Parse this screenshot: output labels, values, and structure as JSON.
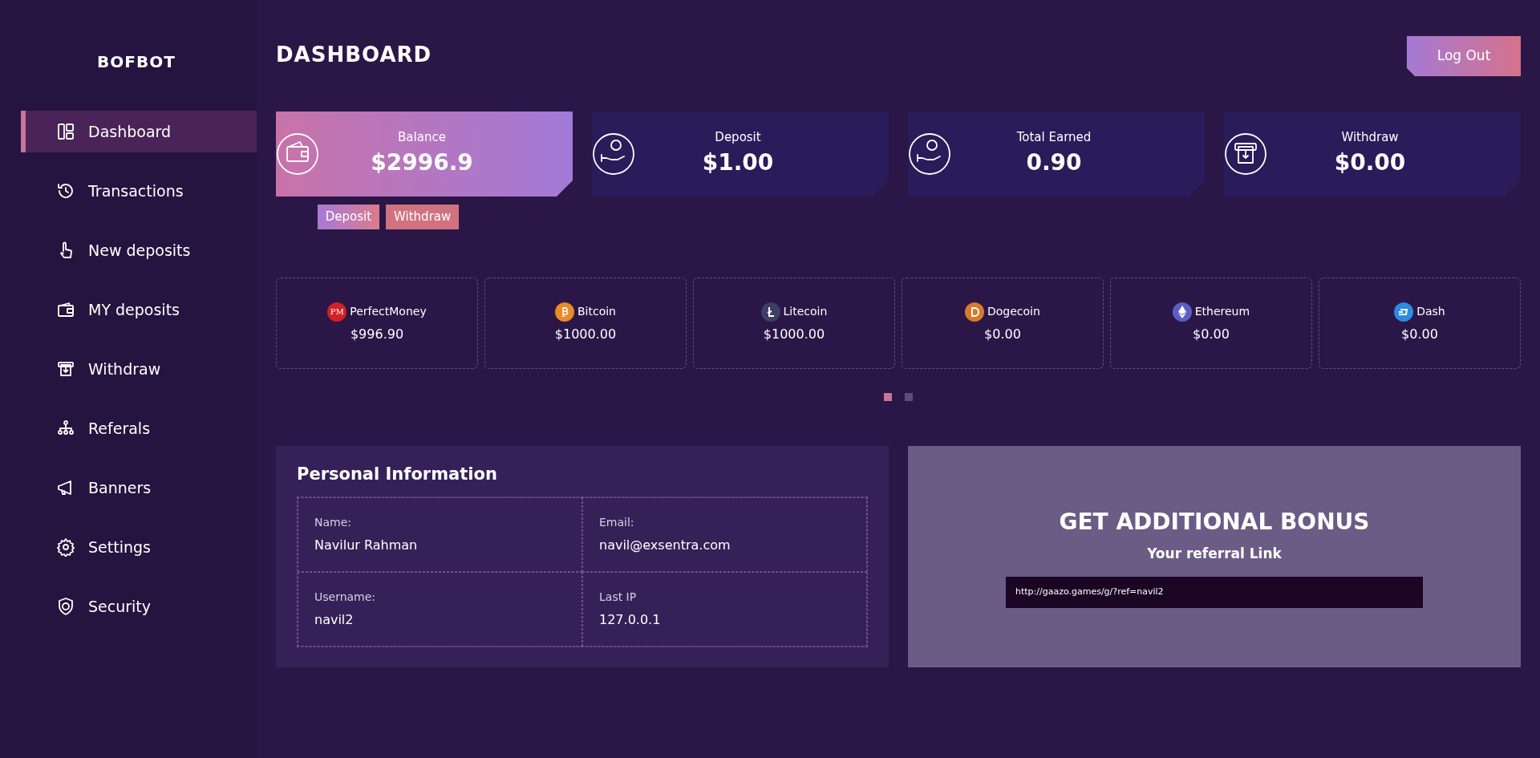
{
  "sidebar": {
    "logo": "BOFBOT",
    "items": [
      {
        "label": "Dashboard",
        "selected": true
      },
      {
        "label": "Transactions",
        "selected": false
      },
      {
        "label": "New deposits",
        "selected": false
      },
      {
        "label": "MY deposits",
        "selected": false
      },
      {
        "label": "Withdraw",
        "selected": false
      },
      {
        "label": "Referals",
        "selected": false
      },
      {
        "label": "Banners",
        "selected": false
      },
      {
        "label": "Settings",
        "selected": false
      },
      {
        "label": "Security",
        "selected": false
      }
    ]
  },
  "header": {
    "title": "DASHBOARD",
    "logout_button": "Log Out"
  },
  "stat_cards": [
    {
      "label": "Balance",
      "value": "$2996.9",
      "highlighted": true
    },
    {
      "label": "Deposit",
      "value": "$1.00",
      "highlighted": false
    },
    {
      "label": "Total Earned",
      "value": "0.90",
      "highlighted": false
    },
    {
      "label": "Withdraw",
      "value": "$0.00",
      "highlighted": false
    }
  ],
  "balance_actions": [
    "Deposit",
    "Withdraw"
  ],
  "currencies": [
    {
      "name": "PerfectMoney",
      "amount": "$996.90",
      "color": "#d42027",
      "logo_text": "PM"
    },
    {
      "name": "Bitcoin",
      "amount": "$1000.00",
      "color": "#e88b2a"
    },
    {
      "name": "Litecoin",
      "amount": "$1000.00",
      "color": "#3d3f66"
    },
    {
      "name": "Dogecoin",
      "amount": "$0.00",
      "color": "#d9792a"
    },
    {
      "name": "Ethereum",
      "amount": "$0.00",
      "color": "#5b5fc4"
    },
    {
      "name": "Dash",
      "amount": "$0.00",
      "color": "#2e8ae0"
    }
  ],
  "carousel_dots": [
    {
      "selected": true
    },
    {
      "selected": false
    }
  ],
  "personal_information": {
    "title": "Personal Information",
    "fields": [
      {
        "label": "Name:",
        "value": "Navilur Rahman"
      },
      {
        "label": "Email:",
        "value": "navil@exsentra.com"
      },
      {
        "label": "Username:",
        "value": "navil2"
      },
      {
        "label": "Last IP",
        "value": "127.0.0.1"
      }
    ]
  },
  "bonus": {
    "title": "GET ADDITIONAL BONUS",
    "subtitle": "Your referral Link",
    "link": "http://gaazo.games/g/?ref=navil2"
  }
}
